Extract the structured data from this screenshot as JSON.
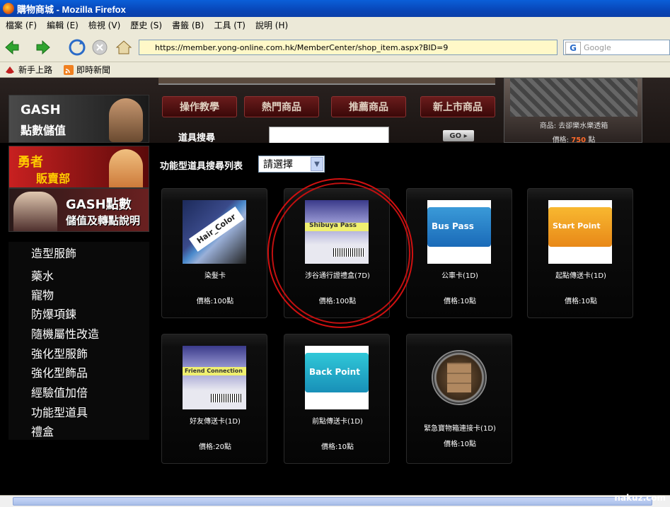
{
  "window": {
    "title": "購物商城 - Mozilla Firefox"
  },
  "menu": [
    "檔案 (F)",
    "編輯 (E)",
    "檢視 (V)",
    "歷史 (S)",
    "書籤 (B)",
    "工具 (T)",
    "說明 (H)"
  ],
  "address": {
    "url": "https://member.yong-online.com.hk/MemberCenter/shop_item.aspx?BID=9"
  },
  "search_engine": {
    "placeholder": "Google"
  },
  "bookmarks": [
    "新手上路",
    "即時新聞"
  ],
  "nav_tabs": [
    "操作教學",
    "熱門商品",
    "推薦商品",
    "新上市商品"
  ],
  "item_search": {
    "label": "道具搜尋",
    "go": "GO"
  },
  "promo": {
    "name": "商品: 去卻樂水樂透箱",
    "price_label": "價格:",
    "price_value": "750",
    "price_unit": "點"
  },
  "banners": {
    "gash": {
      "line1": "GASH",
      "line2": "點數儲值"
    },
    "hero": {
      "line1": "勇者",
      "line2": "販賣部"
    },
    "gash_points": {
      "line1": "GASH點數",
      "line2": "儲值及轉點說明"
    }
  },
  "sidebar": [
    "造型服飾",
    "藥水",
    "寵物",
    "防爆項鍊",
    "隨機屬性改造",
    "強化型服飾",
    "強化型飾品",
    "經驗值加倍",
    "功能型道具",
    "禮盒"
  ],
  "filter": {
    "label": "功能型道具搜尋列表",
    "selected": "請選擇"
  },
  "items": [
    {
      "name": "染髮卡",
      "price": "價格:100點",
      "card_text": "Hair_Color"
    },
    {
      "name": "涉谷通行證禮盒(7D)",
      "price": "價格:100點",
      "card_text": "Shibuya Pass"
    },
    {
      "name": "公車卡(1D)",
      "price": "價格:10點",
      "card_text": "Bus Pass"
    },
    {
      "name": "起點傳送卡(1D)",
      "price": "價格:10點",
      "card_text": "Start Point"
    },
    {
      "name": "好友傳送卡(1D)",
      "price": "價格:20點",
      "card_text": "Friend Connection"
    },
    {
      "name": "前點傳送卡(1D)",
      "price": "價格:10點",
      "card_text": "Back Point"
    },
    {
      "name": "緊急寶物箱連接卡(1D)",
      "price": "價格:10點",
      "card_text": ""
    }
  ],
  "watermark": "nakuz.com",
  "colors": {
    "titlebar": "#0a5fd8",
    "annotation": "#d01010",
    "accent_price": "#ff6a2a"
  }
}
